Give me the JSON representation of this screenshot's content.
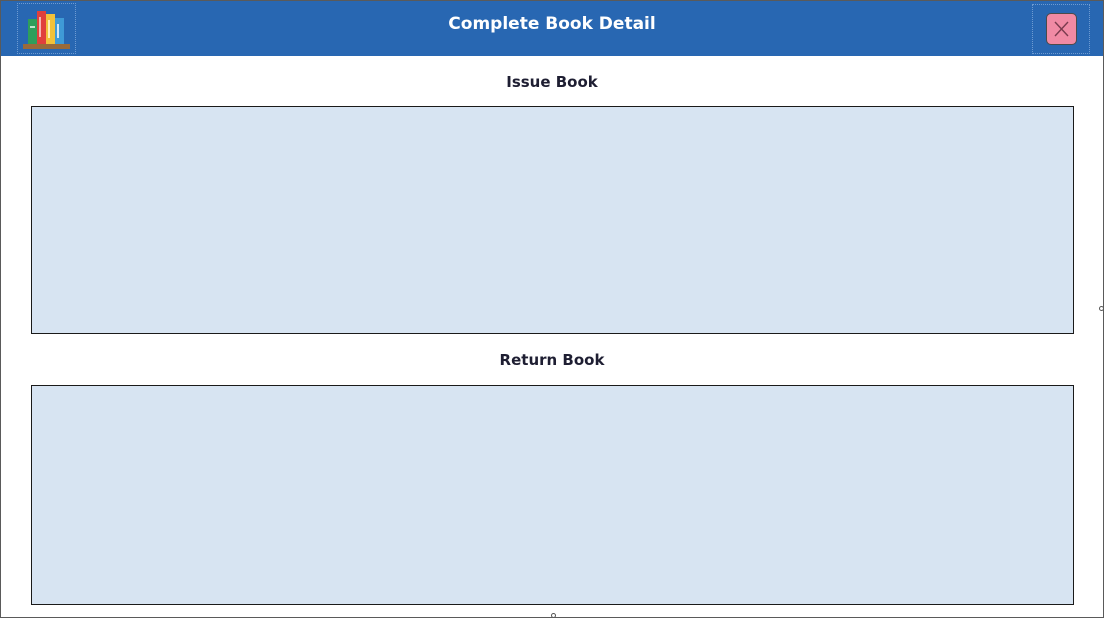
{
  "window": {
    "title": "Complete Book Detail"
  },
  "icons": {
    "logo": "bookshelf-icon",
    "close": "close-icon"
  },
  "sections": {
    "issue": {
      "heading": "Issue Book"
    },
    "return": {
      "heading": "Return Book"
    }
  },
  "colors": {
    "titlebar": "#2867b2",
    "panel": "#d7e4f2",
    "close_button": "#f08aa4"
  }
}
